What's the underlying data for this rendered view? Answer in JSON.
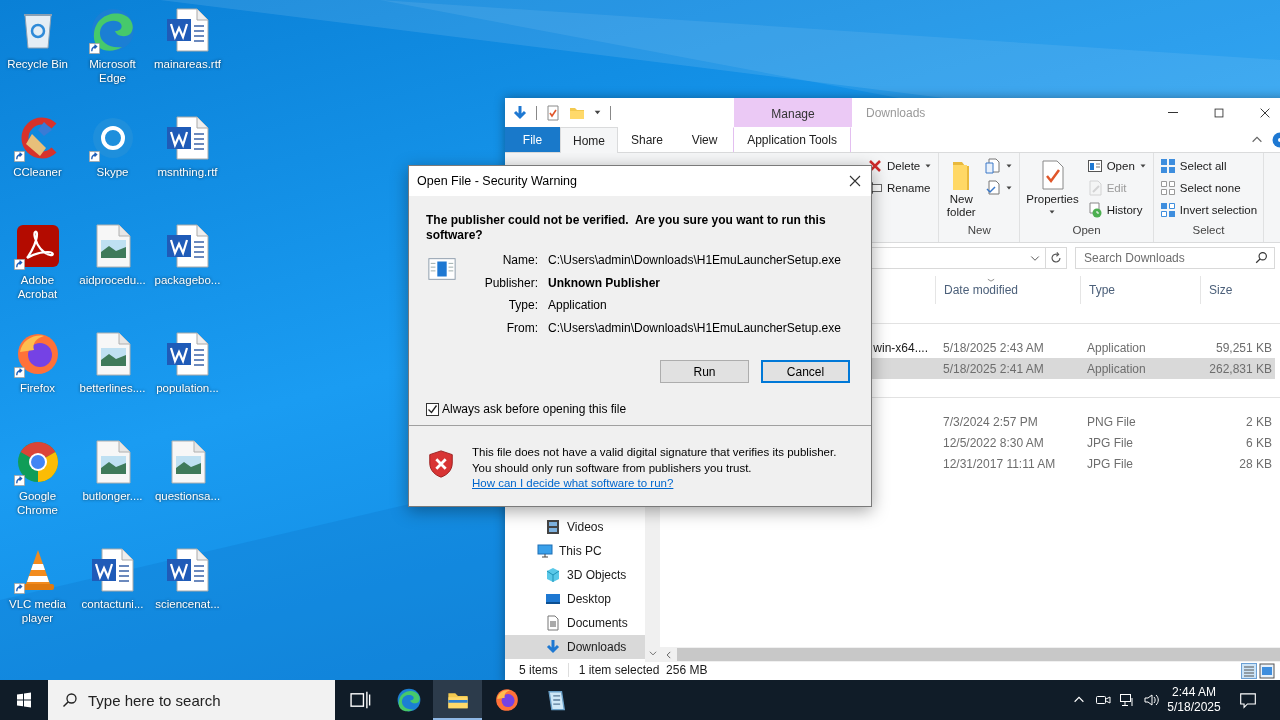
{
  "desktop": {
    "icons": [
      {
        "label": "Recycle Bin",
        "kind": "recycle",
        "shortcut": false
      },
      {
        "label": "CCleaner",
        "kind": "ccleaner",
        "shortcut": true
      },
      {
        "label": "Adobe Acrobat",
        "kind": "acrobat",
        "shortcut": true
      },
      {
        "label": "Firefox",
        "kind": "firefox",
        "shortcut": true
      },
      {
        "label": "Google Chrome",
        "kind": "chrome",
        "shortcut": true
      },
      {
        "label": "VLC media player",
        "kind": "vlc",
        "shortcut": true
      },
      {
        "label": "Microsoft Edge",
        "kind": "edge",
        "shortcut": true
      },
      {
        "label": "Skype",
        "kind": "skype",
        "shortcut": true
      },
      {
        "label": "aidprocedu...",
        "kind": "image",
        "shortcut": false
      },
      {
        "label": "betterlines....",
        "kind": "image",
        "shortcut": false
      },
      {
        "label": "butlonger....",
        "kind": "image",
        "shortcut": false
      },
      {
        "label": "contactuni...",
        "kind": "word",
        "shortcut": false
      },
      {
        "label": "mainareas.rtf",
        "kind": "word",
        "shortcut": false
      },
      {
        "label": "msnthing.rtf",
        "kind": "word",
        "shortcut": false
      },
      {
        "label": "packagebo...",
        "kind": "word",
        "shortcut": false
      },
      {
        "label": "population...",
        "kind": "word",
        "shortcut": false
      },
      {
        "label": "questionsa...",
        "kind": "image",
        "shortcut": false
      },
      {
        "label": "sciencenat...",
        "kind": "word",
        "shortcut": false
      }
    ]
  },
  "explorer": {
    "title": "Downloads",
    "context_group": "Manage",
    "tabs": [
      {
        "label": "File",
        "kind": "file",
        "selected": false
      },
      {
        "label": "Home",
        "kind": "tab",
        "selected": true
      },
      {
        "label": "Share",
        "kind": "tab",
        "selected": false
      },
      {
        "label": "View",
        "kind": "tab",
        "selected": false
      },
      {
        "label": "Application Tools",
        "kind": "context",
        "selected": false
      }
    ],
    "ribbon_groups": [
      {
        "commands": [
          {
            "label": "Delete",
            "kind": "delete",
            "dropdown": true,
            "disabled": false
          },
          {
            "label": "Rename",
            "kind": "rename",
            "dropdown": false,
            "disabled": false
          }
        ]
      },
      {
        "label": "New",
        "large": {
          "label": "New folder",
          "kind": "folder",
          "dropdown": false
        },
        "commands": [
          {
            "kind": "newitem",
            "dropdown": true,
            "disabled": false
          },
          {
            "kind": "easyaccess",
            "dropdown": true,
            "disabled": false
          }
        ]
      },
      {
        "label": "Open",
        "large": {
          "label": "Properties",
          "kind": "properties",
          "dropdown": true
        },
        "commands": [
          {
            "label": "Open",
            "kind": "open",
            "dropdown": true,
            "disabled": false
          },
          {
            "label": "Edit",
            "kind": "edit",
            "dropdown": false,
            "disabled": true
          },
          {
            "label": "History",
            "kind": "history",
            "dropdown": false,
            "disabled": false
          }
        ]
      },
      {
        "label": "Select",
        "commands": [
          {
            "label": "Select all",
            "kind": "selectall",
            "dropdown": false,
            "disabled": false
          },
          {
            "label": "Select none",
            "kind": "selectnone",
            "dropdown": false,
            "disabled": false
          },
          {
            "label": "Invert selection",
            "kind": "invert",
            "dropdown": false,
            "disabled": false
          }
        ]
      }
    ],
    "search_placeholder": "Search Downloads",
    "nav": [
      {
        "children": [
          {
            "label": "Videos",
            "kind": "videos",
            "selected": false
          }
        ]
      },
      {
        "label": "This PC",
        "kind": "pc",
        "selected": false,
        "children": [
          {
            "label": "3D Objects",
            "kind": "objects",
            "selected": false
          },
          {
            "label": "Desktop",
            "kind": "desktop",
            "selected": false
          },
          {
            "label": "Documents",
            "kind": "documents",
            "selected": false
          },
          {
            "label": "Downloads",
            "kind": "downloads",
            "selected": true
          }
        ]
      }
    ],
    "columns": [
      {
        "label": "Date modified",
        "sorted": true
      },
      {
        "label": "Type",
        "sorted": false
      },
      {
        "label": "Size",
        "sorted": false
      }
    ],
    "groups": [
      {
        "rows": [
          {
            "name": "win-x64....",
            "date": "5/18/2025 2:43 AM",
            "type": "Application",
            "size": "59,251 KB",
            "selected": false
          },
          {
            "date": "5/18/2025 2:41 AM",
            "type": "Application",
            "size": "262,831 KB",
            "selected": true
          }
        ]
      },
      {
        "rows": [
          {
            "date": "7/3/2024 2:57 PM",
            "type": "PNG File",
            "size": "2 KB",
            "selected": false
          },
          {
            "date": "12/5/2022 8:30 AM",
            "type": "JPG File",
            "size": "6 KB",
            "selected": false
          },
          {
            "date": "12/31/2017 11:11 AM",
            "type": "JPG File",
            "size": "28 KB",
            "selected": false
          }
        ]
      }
    ],
    "status": [
      "5 items",
      "1 item selected  256 MB"
    ]
  },
  "dialog": {
    "title": "Open File - Security Warning",
    "heading": "The publisher could not be verified.  Are you sure you want to run this software?",
    "fields": [
      {
        "label": "Name:",
        "value": "C:\\Users\\admin\\Downloads\\H1EmuLauncherSetup.exe",
        "emphasis": false
      },
      {
        "label": "Publisher:",
        "value": "Unknown Publisher",
        "emphasis": true
      },
      {
        "label": "Type:",
        "value": "Application",
        "emphasis": false
      },
      {
        "label": "From:",
        "value": "C:\\Users\\admin\\Downloads\\H1EmuLauncherSetup.exe",
        "emphasis": false
      }
    ],
    "buttons": [
      {
        "label": "Run",
        "default": false
      },
      {
        "label": "Cancel",
        "default": true
      }
    ],
    "checkbox": {
      "label": "Always ask before opening this file",
      "checked": true
    },
    "warning": "This file does not have a valid digital signature that verifies its publisher.  You should only run software from publishers you trust.",
    "link": "How can I decide what software to run?"
  },
  "taskbar": {
    "search_placeholder": "Type here to search",
    "apps": [
      {
        "kind": "taskview",
        "active": false
      },
      {
        "kind": "edge",
        "active": false
      },
      {
        "kind": "explorer",
        "active": true
      },
      {
        "kind": "firefox",
        "active": false
      },
      {
        "kind": "notepad",
        "active": false
      }
    ],
    "time": "2:44 AM",
    "date": "5/18/2025"
  }
}
